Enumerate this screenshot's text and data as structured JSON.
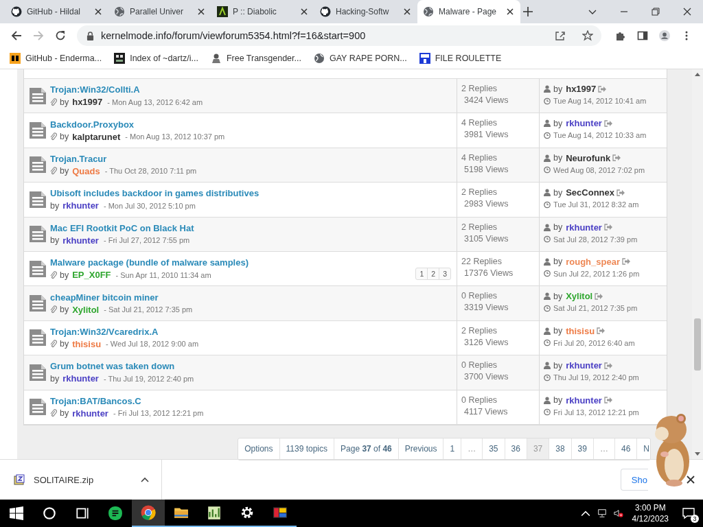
{
  "browser": {
    "tabs": [
      {
        "title": "GitHub - Hildal",
        "kind": "github",
        "selected": false
      },
      {
        "title": "Parallel Univer",
        "kind": "globe",
        "selected": false
      },
      {
        "title": "P :: Diabolic",
        "kind": "diabolic",
        "selected": false
      },
      {
        "title": "Hacking-Softw",
        "kind": "github",
        "selected": false
      },
      {
        "title": "Malware - Page",
        "kind": "globe",
        "selected": true
      }
    ],
    "url": "kernelmode.info/forum/viewforum5354.html?f=16&start=900",
    "bookmarks": [
      {
        "label": "GitHub - Enderma...",
        "kind": "ph"
      },
      {
        "label": "Index of ~dartz/i...",
        "kind": "index"
      },
      {
        "label": "Free Transgender...",
        "kind": "person"
      },
      {
        "label": "GAY RAPE PORN...",
        "kind": "globe"
      },
      {
        "label": "FILE ROULETTE",
        "kind": "mft"
      }
    ]
  },
  "topics": [
    {
      "title": "Trojan:Win32/Collti.A",
      "attachment": true,
      "by": "by",
      "author": {
        "name": "hx1997",
        "color": "#333333"
      },
      "date": "- Mon Aug 13, 2012 6:42 am",
      "replies": "2 Replies",
      "views": "3424 Views",
      "last_by": "by",
      "last_author": {
        "name": "hx1997",
        "color": "#333333"
      },
      "last_date": "Tue Aug 14, 2012 10:41 am"
    },
    {
      "title": "Backdoor.Proxybox",
      "attachment": true,
      "by": "by",
      "author": {
        "name": "kalptarunet",
        "color": "#333333"
      },
      "date": "- Mon Aug 13, 2012 10:37 pm",
      "replies": "4 Replies",
      "views": "3981 Views",
      "last_by": "by",
      "last_author": {
        "name": "rkhunter",
        "color": "#4a3fc4"
      },
      "last_date": "Tue Aug 14, 2012 10:33 am"
    },
    {
      "title": "Trojan.Tracur",
      "attachment": true,
      "by": "by",
      "author": {
        "name": "Quads",
        "color": "#ee7a44"
      },
      "date": "- Thu Oct 28, 2010 7:11 pm",
      "replies": "4 Replies",
      "views": "5198 Views",
      "last_by": "by",
      "last_author": {
        "name": "Neurofunk",
        "color": "#333333"
      },
      "last_date": "Wed Aug 08, 2012 7:02 pm"
    },
    {
      "title": "Ubisoft includes backdoor in games distributives",
      "attachment": false,
      "by": "by",
      "author": {
        "name": "rkhunter",
        "color": "#4a3fc4"
      },
      "date": "- Mon Jul 30, 2012 5:10 pm",
      "replies": "2 Replies",
      "views": "2983 Views",
      "last_by": "by",
      "last_author": {
        "name": "SecConnex",
        "color": "#333333"
      },
      "last_date": "Tue Jul 31, 2012 8:32 am"
    },
    {
      "title": "Mac EFI Rootkit PoC on Black Hat",
      "attachment": false,
      "by": "by",
      "author": {
        "name": "rkhunter",
        "color": "#4a3fc4"
      },
      "date": "- Fri Jul 27, 2012 7:55 pm",
      "replies": "2 Replies",
      "views": "3105 Views",
      "last_by": "by",
      "last_author": {
        "name": "rkhunter",
        "color": "#4a3fc4"
      },
      "last_date": "Sat Jul 28, 2012 7:39 pm"
    },
    {
      "title": "Malware package (bundle of malware samples)",
      "attachment": true,
      "by": "by",
      "author": {
        "name": "EP_X0FF",
        "color": "#2ea62e"
      },
      "date": "- Sun Apr 11, 2010 11:34 am",
      "pages": [
        "1",
        "2",
        "3"
      ],
      "replies": "22 Replies",
      "views": "17376 Views",
      "last_by": "by",
      "last_author": {
        "name": "rough_spear",
        "color": "#ee8855"
      },
      "last_date": "Sun Jul 22, 2012 1:26 pm"
    },
    {
      "title": "cheapMiner bitcoin miner",
      "attachment": true,
      "by": "by",
      "author": {
        "name": "Xylitol",
        "color": "#2ea62e"
      },
      "date": "- Sat Jul 21, 2012 7:35 pm",
      "replies": "0 Replies",
      "views": "3319 Views",
      "last_by": "by",
      "last_author": {
        "name": "Xylitol",
        "color": "#2ea62e"
      },
      "last_date": "Sat Jul 21, 2012 7:35 pm"
    },
    {
      "title": "Trojan:Win32/Vcaredrix.A",
      "attachment": true,
      "by": "by",
      "author": {
        "name": "thisisu",
        "color": "#ee7a44"
      },
      "date": "- Wed Jul 18, 2012 9:00 am",
      "replies": "2 Replies",
      "views": "3126 Views",
      "last_by": "by",
      "last_author": {
        "name": "thisisu",
        "color": "#ee7a44"
      },
      "last_date": "Fri Jul 20, 2012 6:40 am"
    },
    {
      "title": "Grum botnet was taken down",
      "attachment": false,
      "by": "by",
      "author": {
        "name": "rkhunter",
        "color": "#4a3fc4"
      },
      "date": "- Thu Jul 19, 2012 2:40 pm",
      "replies": "0 Replies",
      "views": "3700 Views",
      "last_by": "by",
      "last_author": {
        "name": "rkhunter",
        "color": "#4a3fc4"
      },
      "last_date": "Thu Jul 19, 2012 2:40 pm"
    },
    {
      "title": "Trojan:BAT/Bancos.C",
      "attachment": true,
      "by": "by",
      "author": {
        "name": "rkhunter",
        "color": "#4a3fc4"
      },
      "date": "- Fri Jul 13, 2012 12:21 pm",
      "replies": "0 Replies",
      "views": "4117 Views",
      "last_by": "by",
      "last_author": {
        "name": "rkhunter",
        "color": "#4a3fc4"
      },
      "last_date": "Fri Jul 13, 2012 12:21 pm"
    }
  ],
  "pagination": [
    {
      "label": "Options",
      "kind": "text",
      "selected": false
    },
    {
      "label": "1139 topics",
      "kind": "text",
      "selected": false
    },
    {
      "label": "Page **37** of **46**",
      "kind": "text",
      "selected": false
    },
    {
      "label": "Previous",
      "kind": "link",
      "selected": false
    },
    {
      "label": "1",
      "kind": "link",
      "selected": false
    },
    {
      "label": "…",
      "kind": "gap",
      "selected": false
    },
    {
      "label": "35",
      "kind": "link",
      "selected": false
    },
    {
      "label": "36",
      "kind": "link",
      "selected": false
    },
    {
      "label": "37",
      "kind": "link",
      "selected": true
    },
    {
      "label": "38",
      "kind": "link",
      "selected": false
    },
    {
      "label": "39",
      "kind": "link",
      "selected": false
    },
    {
      "label": "…",
      "kind": "gap",
      "selected": false
    },
    {
      "label": "46",
      "kind": "link",
      "selected": false
    },
    {
      "label": "N",
      "kind": "link",
      "selected": false
    }
  ],
  "downloads": {
    "file": "SOLITAIRE.zip",
    "button": "Sho"
  },
  "taskbar": {
    "apps": [
      {
        "kind": "search",
        "open": false,
        "active": false
      },
      {
        "kind": "taskview",
        "open": false,
        "active": false
      },
      {
        "kind": "notes",
        "open": false,
        "active": false
      },
      {
        "kind": "chrome",
        "open": true,
        "active": true
      },
      {
        "kind": "folder",
        "open": true,
        "active": false
      },
      {
        "kind": "chart",
        "open": true,
        "active": false
      },
      {
        "kind": "gear",
        "open": true,
        "active": false
      },
      {
        "kind": "tiles",
        "open": true,
        "active": false
      }
    ],
    "time": "3:00 PM",
    "date": "4/12/2023",
    "notifications": "3"
  }
}
